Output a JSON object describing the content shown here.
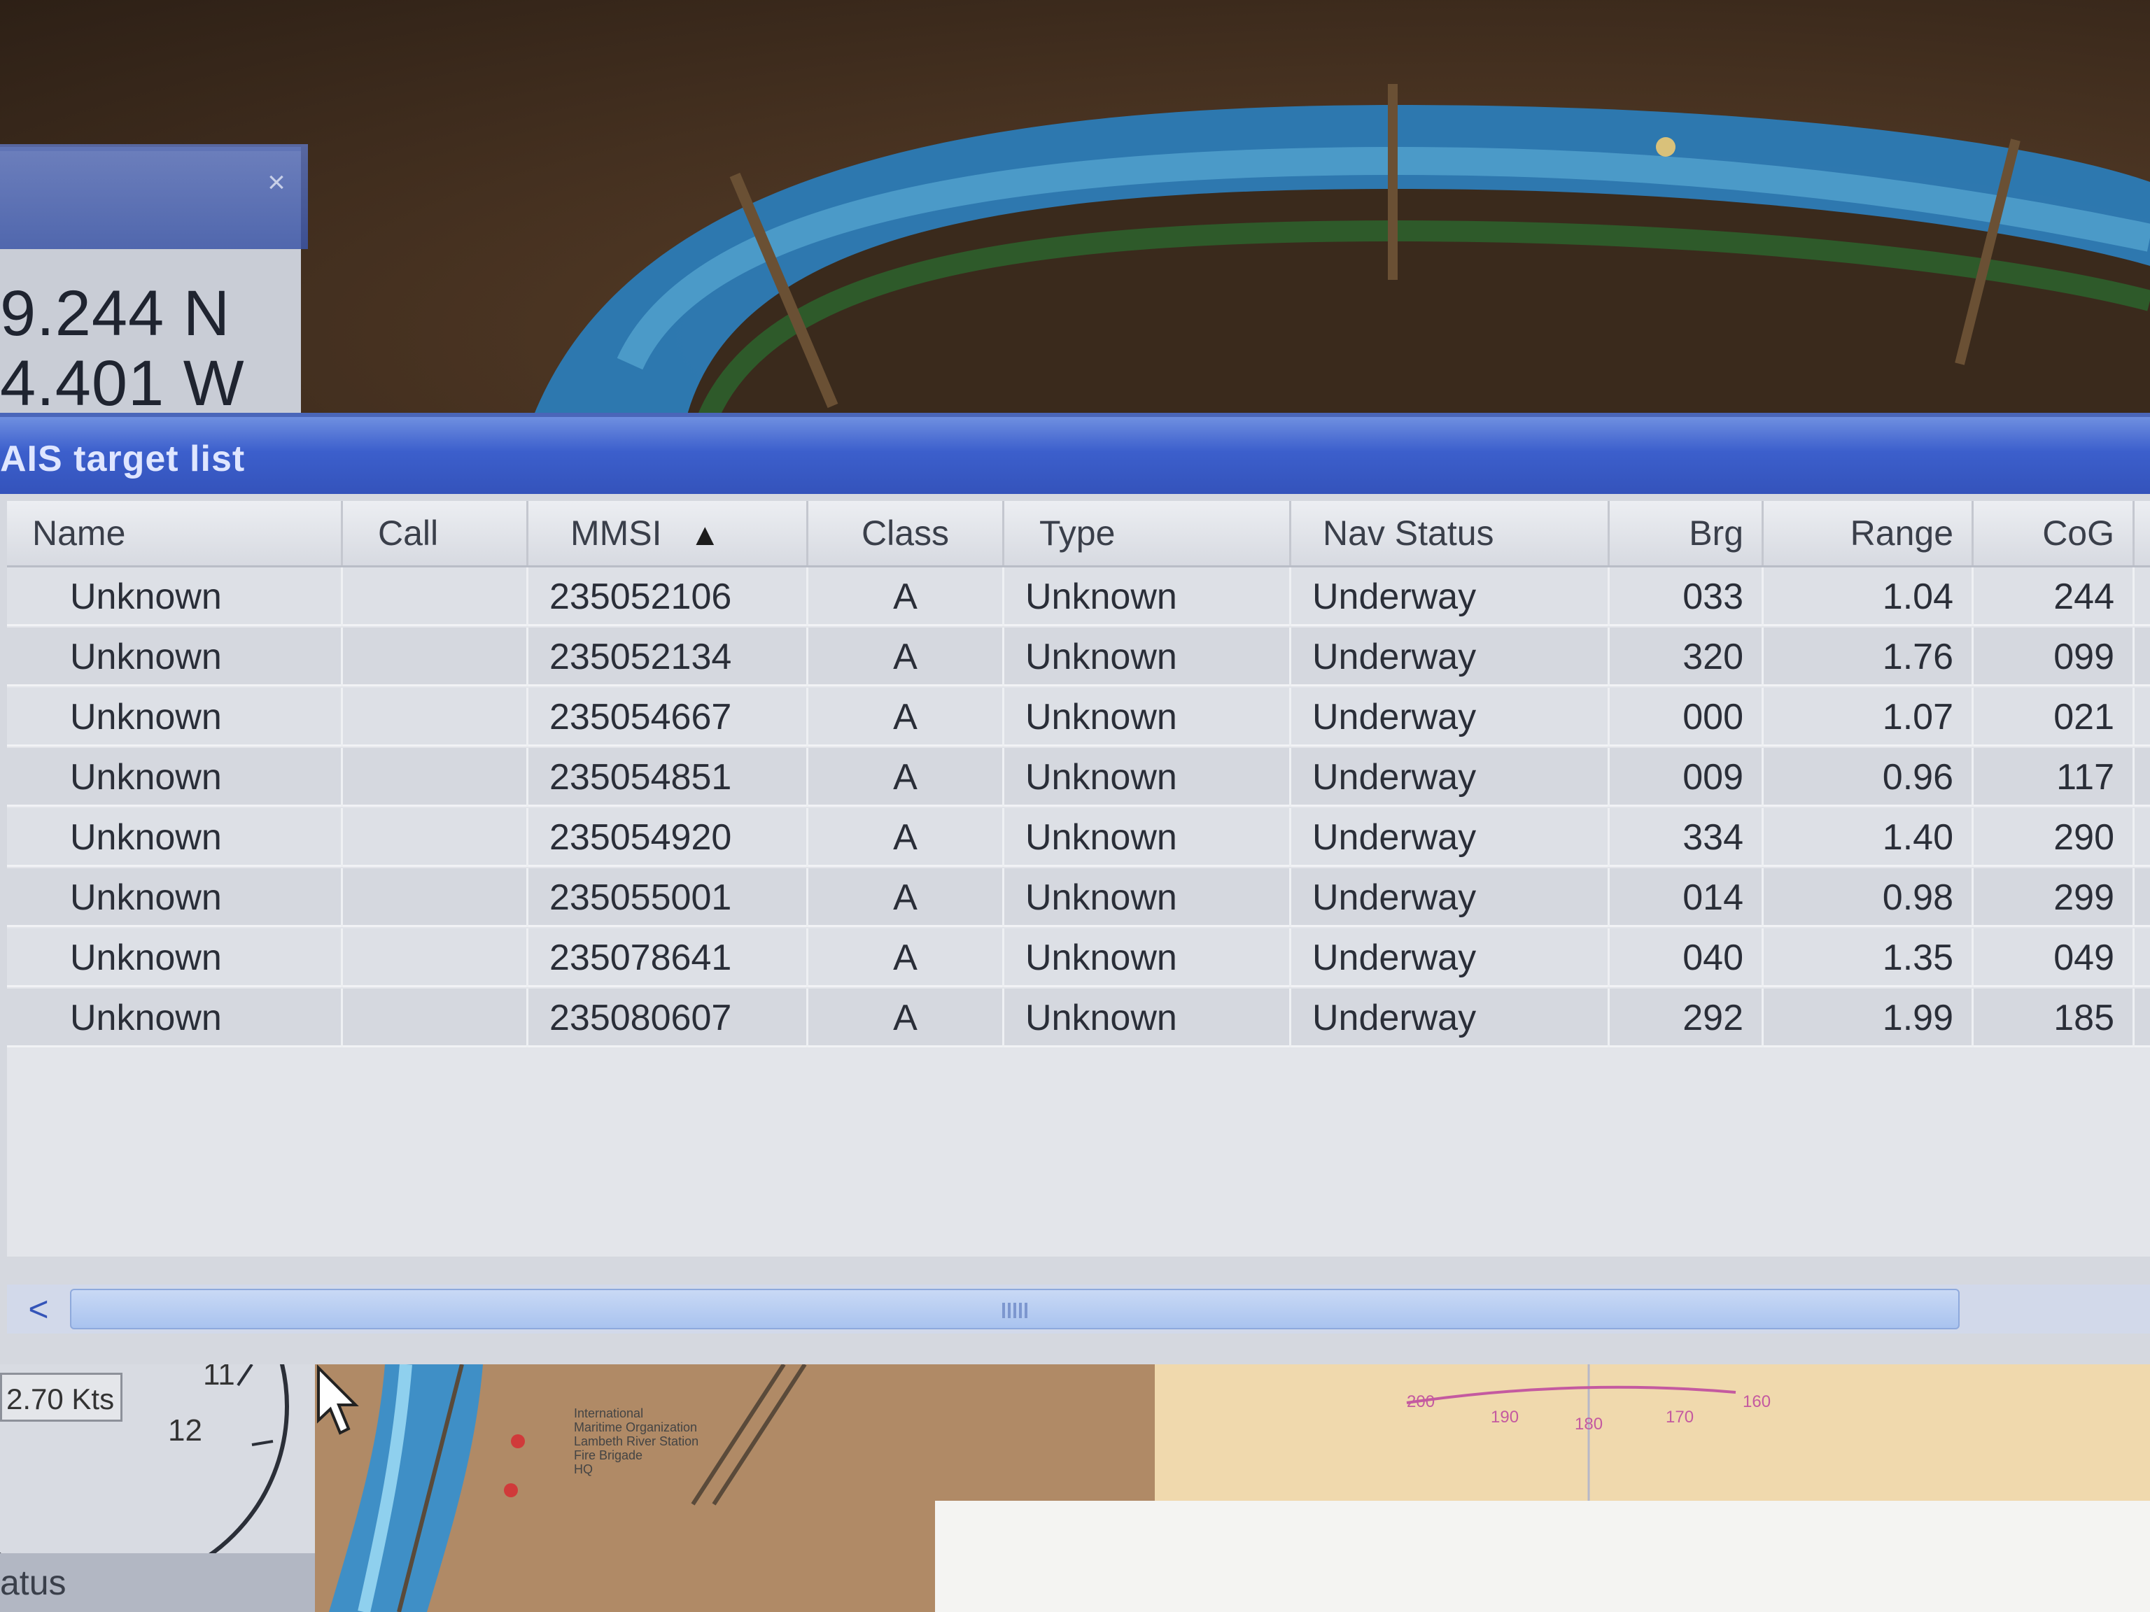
{
  "position_panel": {
    "latitude": "9.244 N",
    "longitude": "4.401 W",
    "close_glyph": "×"
  },
  "ais_window": {
    "title": "AIS target list",
    "columns": [
      {
        "key": "name",
        "label": "Name"
      },
      {
        "key": "call",
        "label": "Call"
      },
      {
        "key": "mmsi",
        "label": "MMSI"
      },
      {
        "key": "class",
        "label": "Class"
      },
      {
        "key": "type",
        "label": "Type"
      },
      {
        "key": "nav_status",
        "label": "Nav Status"
      },
      {
        "key": "brg",
        "label": "Brg"
      },
      {
        "key": "range",
        "label": "Range"
      },
      {
        "key": "cog",
        "label": "CoG"
      }
    ],
    "sort_column": "mmsi",
    "sort_indicator": "▲",
    "rows": [
      {
        "name": "Unknown",
        "call": "",
        "mmsi": "235052106",
        "class": "A",
        "type": "Unknown",
        "nav_status": "Underway",
        "brg": "033",
        "range": "1.04",
        "cog": "244"
      },
      {
        "name": "Unknown",
        "call": "",
        "mmsi": "235052134",
        "class": "A",
        "type": "Unknown",
        "nav_status": "Underway",
        "brg": "320",
        "range": "1.76",
        "cog": "099"
      },
      {
        "name": "Unknown",
        "call": "",
        "mmsi": "235054667",
        "class": "A",
        "type": "Unknown",
        "nav_status": "Underway",
        "brg": "000",
        "range": "1.07",
        "cog": "021"
      },
      {
        "name": "Unknown",
        "call": "",
        "mmsi": "235054851",
        "class": "A",
        "type": "Unknown",
        "nav_status": "Underway",
        "brg": "009",
        "range": "0.96",
        "cog": "117"
      },
      {
        "name": "Unknown",
        "call": "",
        "mmsi": "235054920",
        "class": "A",
        "type": "Unknown",
        "nav_status": "Underway",
        "brg": "334",
        "range": "1.40",
        "cog": "290"
      },
      {
        "name": "Unknown",
        "call": "",
        "mmsi": "235055001",
        "class": "A",
        "type": "Unknown",
        "nav_status": "Underway",
        "brg": "014",
        "range": "0.98",
        "cog": "299"
      },
      {
        "name": "Unknown",
        "call": "",
        "mmsi": "235078641",
        "class": "A",
        "type": "Unknown",
        "nav_status": "Underway",
        "brg": "040",
        "range": "1.35",
        "cog": "049"
      },
      {
        "name": "Unknown",
        "call": "",
        "mmsi": "235080607",
        "class": "A",
        "type": "Unknown",
        "nav_status": "Underway",
        "brg": "292",
        "range": "1.99",
        "cog": "185"
      }
    ],
    "scroll_left_glyph": "<"
  },
  "bottom": {
    "speed": "2.70 Kts",
    "dial_numbers": [
      "11",
      "12"
    ],
    "status_label": "atus",
    "compass_labels": [
      "200",
      "190",
      "180",
      "170",
      "160"
    ],
    "map_labels": [
      "International",
      "Maritime Organization",
      "Lambeth River Station",
      "Fire Brigade",
      "HQ"
    ]
  },
  "colors": {
    "title_bar": "#3c5fcc",
    "water_blue": "#2f78b8",
    "land_brown": "#4a3422",
    "compass_magenta": "#c45aa0"
  }
}
